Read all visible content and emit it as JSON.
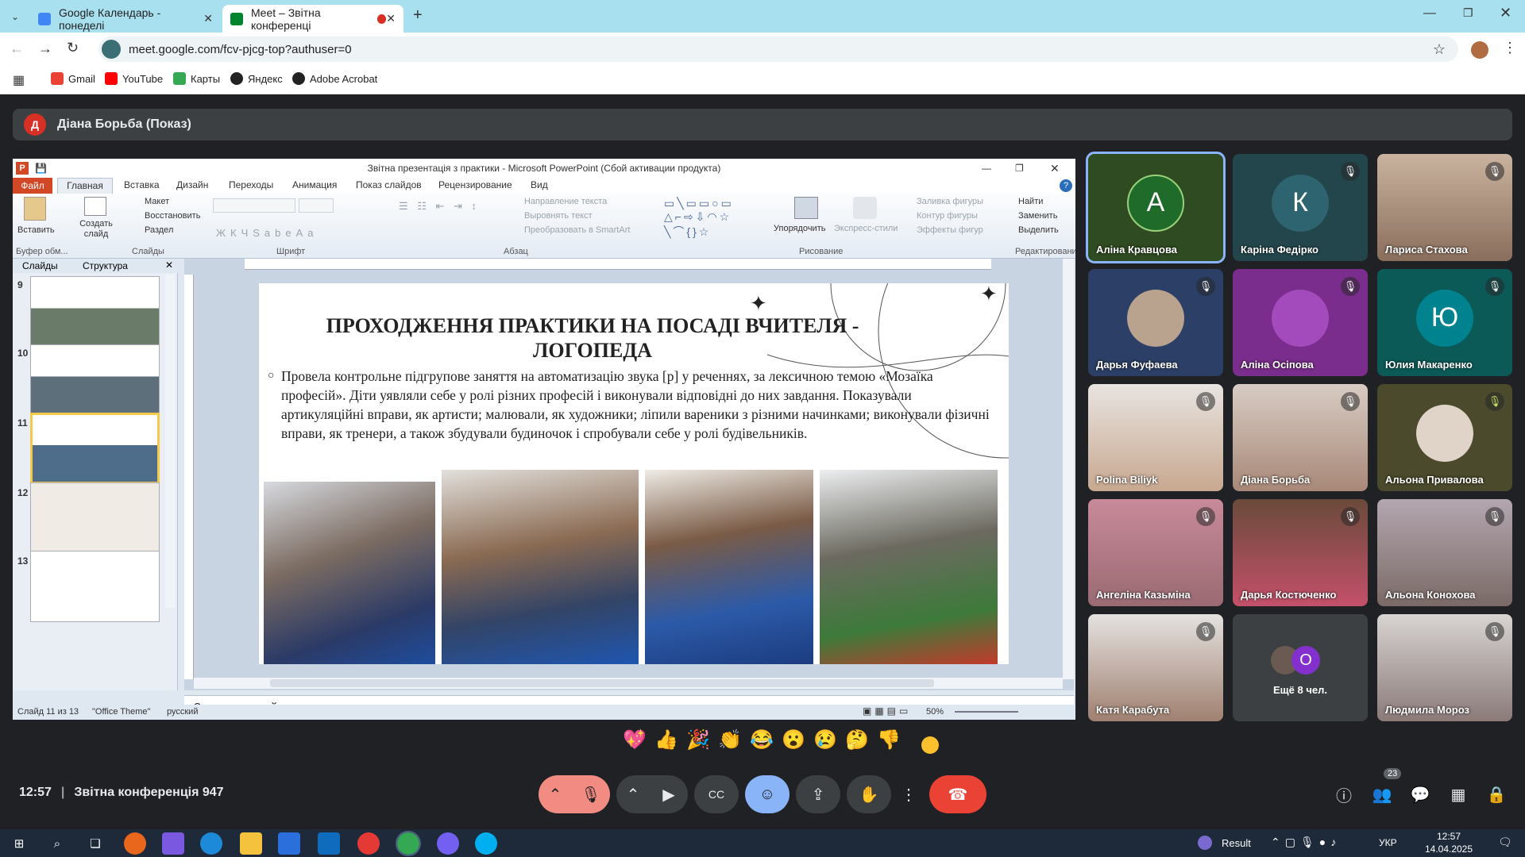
{
  "browser": {
    "tabs": [
      {
        "label": "Google Календарь - понеделі",
        "active": false
      },
      {
        "label": "Meet – Звітна конференці",
        "active": true
      }
    ],
    "url": "meet.google.com/fcv-pjcg-top?authuser=0",
    "bookmarks": [
      "Gmail",
      "YouTube",
      "Карты",
      "Яндекс",
      "Adobe Acrobat"
    ]
  },
  "meet": {
    "presenter": "Діана Борьба (Показ)",
    "presenter_initial": "Д",
    "time": "12:57",
    "meeting_name": "Звітна конференція 947",
    "participant_count": "23",
    "participants": [
      {
        "name": "Аліна Кравцова",
        "initial": "А",
        "active": true,
        "muted": false
      },
      {
        "name": "Каріна Федірко",
        "initial": "К",
        "muted": true
      },
      {
        "name": "Лариса Стахова",
        "muted": true
      },
      {
        "name": "Дарья Фуфаева",
        "muted": true
      },
      {
        "name": "Аліна Осіпова",
        "muted": true
      },
      {
        "name": "Юлия Макаренко",
        "initial": "Ю",
        "muted": true
      },
      {
        "name": "Polina Biliyk",
        "muted": true
      },
      {
        "name": "Діана Борьба",
        "muted": true
      },
      {
        "name": "Альона Привалова",
        "muted": true
      },
      {
        "name": "Ангеліна Казьміна",
        "muted": true
      },
      {
        "name": "Дарья Костюченко",
        "muted": true
      },
      {
        "name": "Альона Конохова",
        "muted": true
      },
      {
        "name": "Катя Карабута",
        "muted": true
      },
      {
        "name": "Ещё 8 чел.",
        "initial": "O"
      },
      {
        "name": "Людмила Мороз",
        "muted": true
      }
    ],
    "reactions": [
      "💖",
      "👍",
      "🎉",
      "👏",
      "😂",
      "😮",
      "😢",
      "🤔",
      "👎"
    ]
  },
  "ppt": {
    "window_title": "Звітна презентація з практики  -  Microsoft PowerPoint (Сбой активации продукта)",
    "tabs": [
      "Файл",
      "Главная",
      "Вставка",
      "Дизайн",
      "Переходы",
      "Анимация",
      "Показ слайдов",
      "Рецензирование",
      "Вид"
    ],
    "ribbon": {
      "paste": "Вставить",
      "clipboard": "Буфер обм...",
      "new_slide": "Создать слайд",
      "layout": "Макет",
      "reset": "Восстановить",
      "section": "Раздел",
      "slides_group": "Слайды",
      "font_group": "Шрифт",
      "text_dir": "Направление текста",
      "align_text": "Выровнять текст",
      "smartart": "Преобразовать в SmartArt",
      "paragraph_group": "Абзац",
      "arrange": "Упорядочить",
      "quick_styles": "Экспресс-стили",
      "shape_fill": "Заливка фигуры",
      "shape_outline": "Контур фигуры",
      "shape_effects": "Эффекты фигур",
      "drawing_group": "Рисование",
      "find": "Найти",
      "replace": "Заменить",
      "select": "Выделить",
      "editing_group": "Редактирование"
    },
    "pane_tabs": [
      "Слайды",
      "Структура"
    ],
    "thumb_numbers": [
      "9",
      "10",
      "11",
      "12",
      "13"
    ],
    "slide_title": "ПРОХОДЖЕННЯ ПРАКТИКИ НА ПОСАДІ ВЧИТЕЛЯ - ЛОГОПЕДА",
    "slide_body": "Провела контрольне підгрупове заняття на автоматизацію звука [р] у реченнях, за лексичною темою «Мозаїка професій». Діти уявляли себе у ролі різних професій і виконували відповідні до них завдання. Показували артикуляційні вправи, як артисти; малювали, як художники; ліпили вареники з різними начинками; виконували фізичні вправи, як тренери, а також збудували  будиночок і спробували себе у ролі будівельників.",
    "bullet": "○",
    "notes_placeholder": "Заметки к слайду",
    "status_slide": "Слайд 11 из 13",
    "status_theme": "\"Office Theme\"",
    "status_lang": "русский",
    "zoom": "50%"
  },
  "taskbar": {
    "result_label": "Result",
    "lang": "УКР",
    "time": "12:57",
    "date": "14.04.2025"
  }
}
